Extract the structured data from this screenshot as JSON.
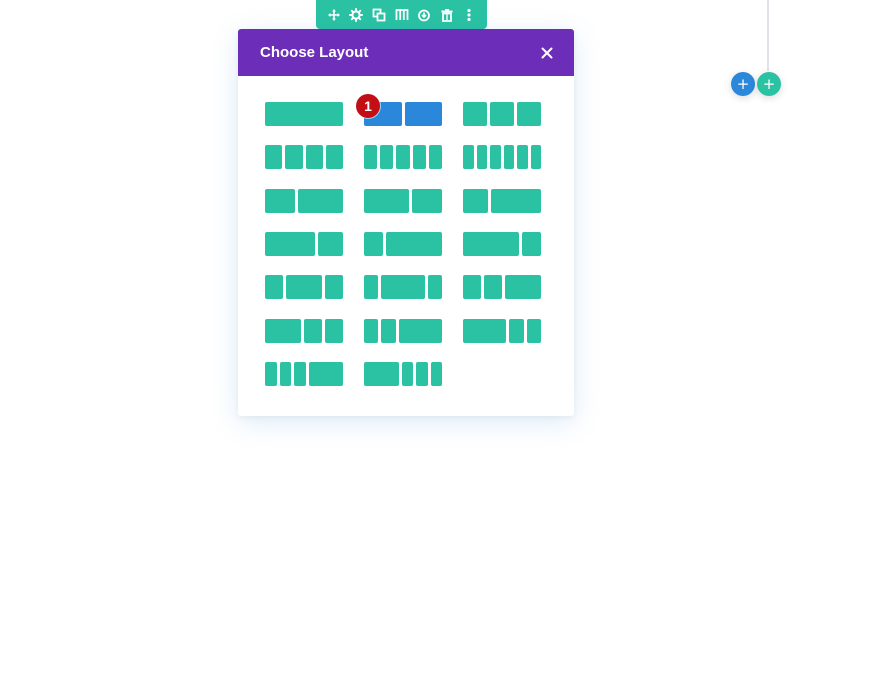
{
  "toolbar": {
    "icons": [
      "move-icon",
      "gear-icon",
      "duplicate-icon",
      "columns-icon",
      "power-icon",
      "trash-icon",
      "more-vertical-icon"
    ],
    "color": "#2bc2a3"
  },
  "modal": {
    "title": "Choose Layout",
    "header_color": "#6c2eb9",
    "close_icon": "close-icon"
  },
  "layouts": [
    {
      "id": "1",
      "ratios": [
        1
      ],
      "selected": false
    },
    {
      "id": "1_2-1_2",
      "ratios": [
        1,
        1
      ],
      "selected": true
    },
    {
      "id": "1_3-1_3-1_3",
      "ratios": [
        1,
        1,
        1
      ],
      "selected": false
    },
    {
      "id": "1_4x4",
      "ratios": [
        1,
        1,
        1,
        1
      ],
      "selected": false
    },
    {
      "id": "1_5x5",
      "ratios": [
        1,
        1,
        1,
        1,
        1
      ],
      "selected": false
    },
    {
      "id": "1_6x6",
      "ratios": [
        1,
        1,
        1,
        1,
        1,
        1
      ],
      "selected": false
    },
    {
      "id": "2_5-3_5",
      "ratios": [
        2,
        3
      ],
      "selected": false
    },
    {
      "id": "3_5-2_5",
      "ratios": [
        3,
        2
      ],
      "selected": false
    },
    {
      "id": "1_3-2_3",
      "ratios": [
        1,
        2
      ],
      "selected": false
    },
    {
      "id": "2_3-1_3",
      "ratios": [
        2,
        1
      ],
      "selected": false
    },
    {
      "id": "1_4-3_4",
      "ratios": [
        1,
        3
      ],
      "selected": false
    },
    {
      "id": "3_4-1_4",
      "ratios": [
        3,
        1
      ],
      "selected": false
    },
    {
      "id": "1_4-1_2-1_4",
      "ratios": [
        1,
        2,
        1
      ],
      "selected": false
    },
    {
      "id": "1_5-3_5-1_5",
      "ratios": [
        1,
        3,
        1
      ],
      "selected": false
    },
    {
      "id": "1_4-1_4-1_2",
      "ratios": [
        1,
        1,
        2
      ],
      "selected": false
    },
    {
      "id": "1_2-1_4-1_4",
      "ratios": [
        2,
        1,
        1
      ],
      "selected": false
    },
    {
      "id": "1_5-1_5-3_5",
      "ratios": [
        1,
        1,
        3
      ],
      "selected": false
    },
    {
      "id": "3_5-1_5-1_5",
      "ratios": [
        3,
        1,
        1
      ],
      "selected": false
    },
    {
      "id": "1_6-1_6-1_6-1_2",
      "ratios": [
        1,
        1,
        1,
        3
      ],
      "selected": false
    },
    {
      "id": "1_2-1_6-1_6-1_6",
      "ratios": [
        3,
        1,
        1,
        1
      ],
      "selected": false
    }
  ],
  "callout": {
    "number": "1",
    "color": "#c10f15"
  },
  "add_buttons": [
    {
      "name": "add-row-button",
      "label": "+",
      "color": "#2b87da"
    },
    {
      "name": "add-section-button",
      "label": "+",
      "color": "#2bc2a3"
    }
  ],
  "colors": {
    "teal": "#2bc2a3",
    "blue": "#2b87da",
    "purple": "#6c2eb9"
  }
}
